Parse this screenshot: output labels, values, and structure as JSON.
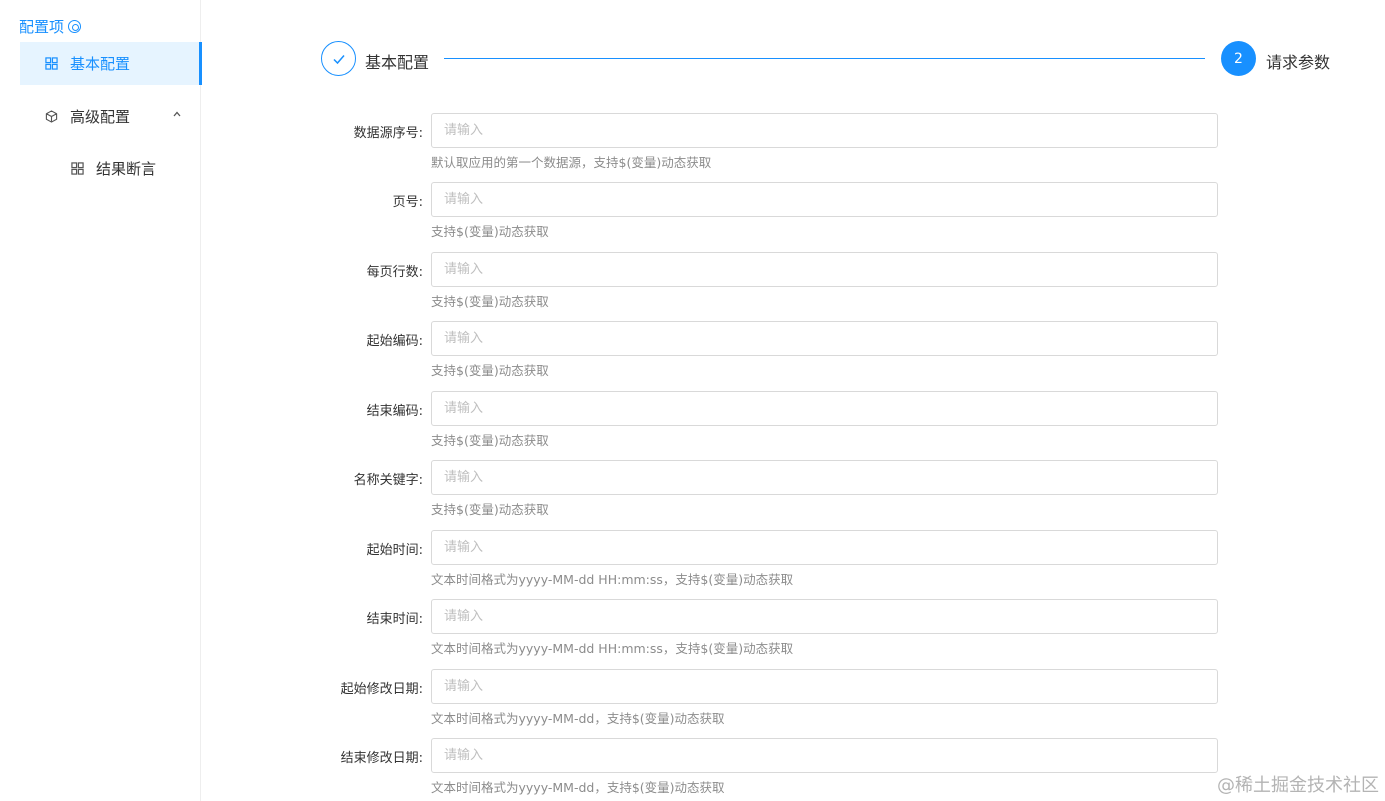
{
  "sidebar": {
    "header": "配置项",
    "items": [
      {
        "label": "基本配置",
        "active": true
      },
      {
        "label": "高级配置",
        "expanded": true
      },
      {
        "label": "结果断言"
      }
    ]
  },
  "steps": [
    {
      "title": "基本配置",
      "status": "finished"
    },
    {
      "number": "2",
      "title": "请求参数",
      "status": "current"
    }
  ],
  "form": {
    "placeholder": "请输入",
    "fields": [
      {
        "label": "数据源序号:",
        "help": "默认取应用的第一个数据源，支持$(变量)动态获取"
      },
      {
        "label": "页号:",
        "help": "支持$(变量)动态获取"
      },
      {
        "label": "每页行数:",
        "help": "支持$(变量)动态获取"
      },
      {
        "label": "起始编码:",
        "help": "支持$(变量)动态获取"
      },
      {
        "label": "结束编码:",
        "help": "支持$(变量)动态获取"
      },
      {
        "label": "名称关键字:",
        "help": "支持$(变量)动态获取"
      },
      {
        "label": "起始时间:",
        "help": "文本时间格式为yyyy-MM-dd HH:mm:ss，支持$(变量)动态获取"
      },
      {
        "label": "结束时间:",
        "help": "文本时间格式为yyyy-MM-dd HH:mm:ss，支持$(变量)动态获取"
      },
      {
        "label": "起始修改日期:",
        "help": "文本时间格式为yyyy-MM-dd，支持$(变量)动态获取"
      },
      {
        "label": "结束修改日期:",
        "help": "文本时间格式为yyyy-MM-dd，支持$(变量)动态获取"
      }
    ]
  },
  "watermark": "@稀土掘金技术社区",
  "colors": {
    "accent": "#1890ff",
    "active_bg": "#e6f4ff"
  }
}
